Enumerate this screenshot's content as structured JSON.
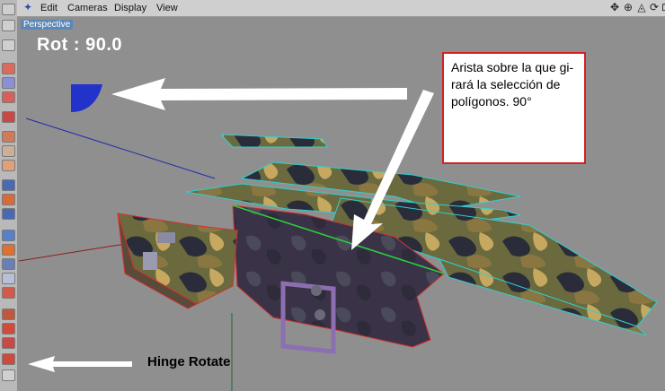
{
  "menu": {
    "items": [
      "Edit",
      "Cameras",
      "Display",
      "View"
    ]
  },
  "viewport": {
    "label": "Perspective",
    "rotation_readout": "Rot : 90.0"
  },
  "annotations": {
    "note": "Arista sobre la que gi-rará la selección de polígonos. 90°",
    "hinge_label": "Hinge Rotate"
  },
  "colors": {
    "background": "#8f8f8f",
    "selection_edge": "#2fd0d0",
    "red_edge": "#d33030",
    "note_border": "#d32020"
  }
}
